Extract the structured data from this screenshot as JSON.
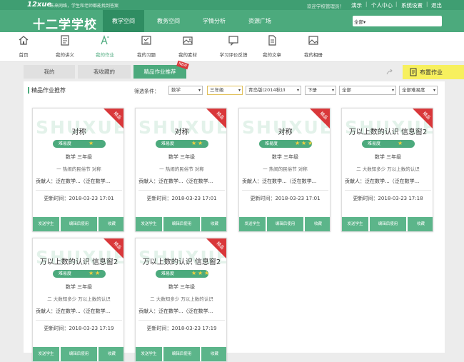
{
  "topbar": {
    "logo": "12xue",
    "slogan": "未来网络，学生和老师都能找到答案",
    "welcome": "欢迎学校管理员！",
    "links": [
      "演示",
      "个人中心",
      "系统设置",
      "退出"
    ]
  },
  "header": {
    "school": "十二学学校",
    "nav": [
      "教学空间",
      "教务空间",
      "学情分析",
      "资源广场"
    ],
    "search_scope": "全部",
    "search_value": ""
  },
  "toolbar": [
    "首页",
    "我的讲义",
    "我的作业",
    "我的习题",
    "我的素材",
    "学习评价反馈",
    "我的文章",
    "我的相册"
  ],
  "tabs": {
    "mine": "我的",
    "favorites": "我收藏的",
    "featured": "精品作业推荐",
    "new_badge": "NEW",
    "arrange": "布置作业"
  },
  "section_title": "精品作业推荐",
  "filter": {
    "label": "筛选条件：",
    "subject": "数学",
    "grade": "三年级",
    "edition": "青岛版(2014秋)/I",
    "volume": "下册",
    "unit": "全部",
    "difficulty": "全部难易度"
  },
  "cards": [
    {
      "watermark": "SHUXUE",
      "ribbon": "精品",
      "title": "对称",
      "difficulty": "难易度",
      "stars": 1,
      "subject_grade": "数学  三年级",
      "topic": "一 热闹的民俗节  对称",
      "contributor": "贡献人：泛在数学...（泛在数学...",
      "updated": "更新时间：2018-03-23 17:01",
      "actions": [
        "发送学生",
        "编辑后使用",
        "收藏"
      ]
    },
    {
      "watermark": "SHUXUE",
      "ribbon": "精品",
      "title": "对称",
      "difficulty": "难易度",
      "stars": 2,
      "subject_grade": "数学  三年级",
      "topic": "一 热闹的民俗节  对称",
      "contributor": "贡献人：泛在数学...（泛在数学...",
      "updated": "更新时间：2018-03-23 17:01",
      "actions": [
        "发送学生",
        "编辑后使用",
        "收藏"
      ]
    },
    {
      "watermark": "SHUXUE",
      "ribbon": "精品",
      "title": "对称",
      "difficulty": "难易度",
      "stars": 3,
      "subject_grade": "数学  三年级",
      "topic": "一 热闹的民俗节  对称",
      "contributor": "贡献人：泛在数学...（泛在数学...",
      "updated": "更新时间：2018-03-23 17:01",
      "actions": [
        "发送学生",
        "编辑后使用",
        "收藏"
      ]
    },
    {
      "watermark": "SHUXUE",
      "ribbon": "精品",
      "title": "万以上数的认识 信息窗2",
      "difficulty": "难易度",
      "stars": 1,
      "subject_grade": "数学  三年级",
      "topic": "二 大数知多少  万以上数的认识",
      "contributor": "贡献人：泛在数学...（泛在数学...",
      "updated": "更新时间：2018-03-23 17:18",
      "actions": [
        "发送学生",
        "编辑后使用",
        "收藏"
      ]
    },
    {
      "watermark": "SHUXUE",
      "ribbon": "精品",
      "title": "万以上数的认识 信息窗2",
      "difficulty": "难易度",
      "stars": 2,
      "subject_grade": "数学  三年级",
      "topic": "二 大数知多少  万以上数的认识",
      "contributor": "贡献人：泛在数学...（泛在数学...",
      "updated": "更新时间：2018-03-23 17:19",
      "actions": [
        "发送学生",
        "编辑后使用",
        "收藏"
      ]
    },
    {
      "watermark": "SHUXUE",
      "ribbon": "精品",
      "title": "万以上数的认识 信息窗2",
      "difficulty": "难易度",
      "stars": 3,
      "subject_grade": "数学  三年级",
      "topic": "二 大数知多少  万以上数的认识",
      "contributor": "贡献人：泛在数学...（泛在数学...",
      "updated": "更新时间：2018-03-23 17:19",
      "actions": [
        "发送学生",
        "编辑后使用",
        "收藏"
      ]
    }
  ],
  "colors": {
    "brand": "#4caa7d",
    "nav_active": "#2f8d62",
    "ribbon": "#d9373a",
    "star": "#f4d03f",
    "arrange": "#f7f05e"
  }
}
